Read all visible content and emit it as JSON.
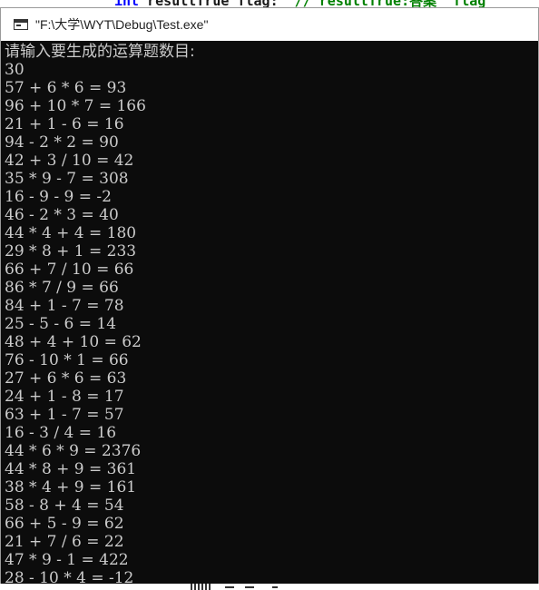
{
  "background_editor": {
    "code_keyword": "int",
    "code_text": " resultTrue flag:",
    "code_comment": "  // resultTrue:答案  flag"
  },
  "window": {
    "title": "\"F:\\大学\\WYT\\Debug\\Test.exe\"",
    "title_icon": "console-window-icon"
  },
  "console": {
    "prompt": "请输入要生成的运算题数目:",
    "input": "30",
    "problems": [
      "57 + 6 * 6 = 93",
      "96 + 10 * 7 = 166",
      "21 + 1 - 6 = 16",
      "94 - 2 * 2 = 90",
      "42 + 3 / 10 = 42",
      "35 * 9 - 7 = 308",
      "16 - 9 - 9 = -2",
      "46 - 2 * 3 = 40",
      "44 * 4 + 4 = 180",
      "29 * 8 + 1 = 233",
      "66 + 7 / 10 = 66",
      "86 * 7 / 9 = 66",
      "84 + 1 - 7 = 78",
      "25 - 5 - 6 = 14",
      "48 + 4 + 10 = 62",
      "76 - 10 * 1 = 66",
      "27 + 6 * 6 = 63",
      "24 + 1 - 8 = 17",
      "63 + 1 - 7 = 57",
      "16 - 3 / 4 = 16",
      "44 * 6 * 9 = 2376",
      "44 * 8 + 9 = 361",
      "38 * 4 + 9 = 161",
      "58 - 8 + 4 = 54",
      "66 + 5 - 9 = 62",
      "21 + 7 / 6 = 22",
      "47 * 9 - 1 = 422",
      "28 - 10 * 4 = -12"
    ]
  },
  "colors": {
    "console_bg": "#0c0c0c",
    "console_text": "#cccccc",
    "keyword": "#0000ff",
    "comment": "#008000"
  }
}
